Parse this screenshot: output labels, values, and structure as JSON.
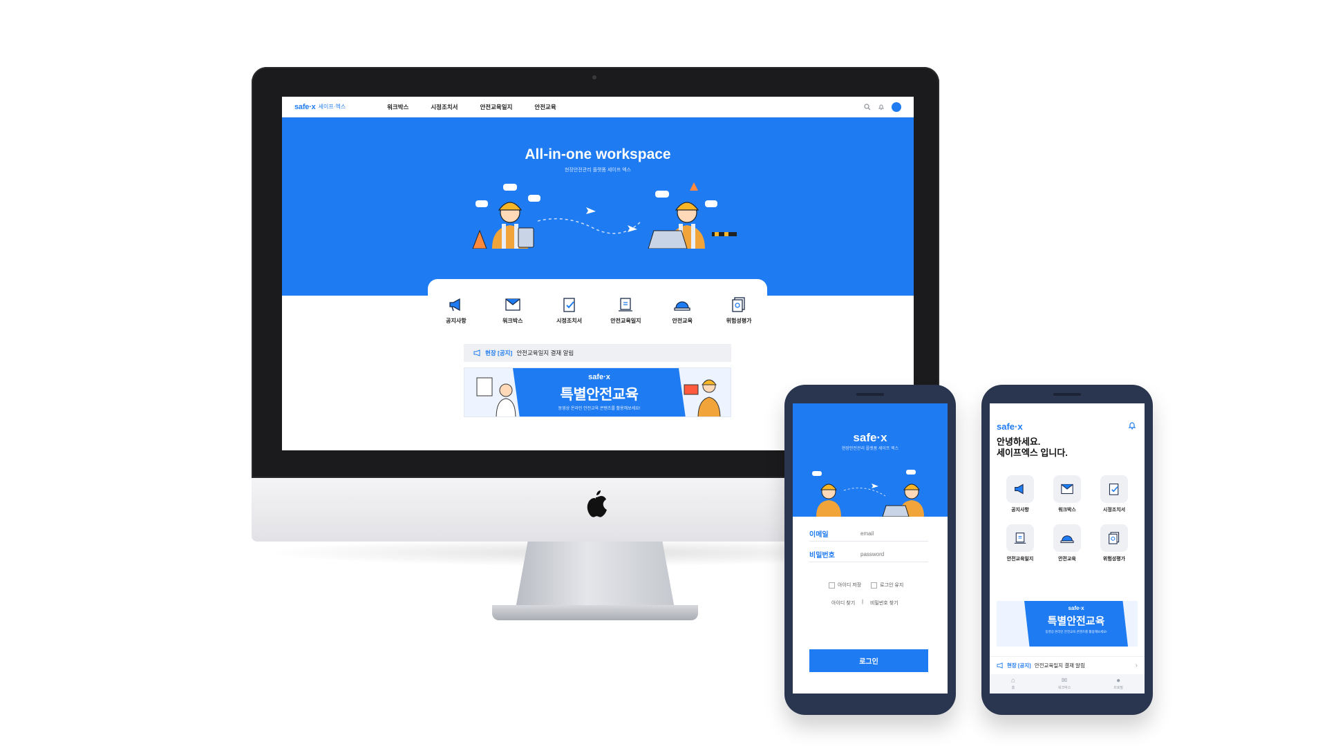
{
  "desktop": {
    "logo": "safe·x",
    "logo_sub": "세이프·엑스",
    "nav": [
      "워크박스",
      "시정조치서",
      "안전교육일지",
      "안전교육"
    ],
    "hero_title": "All-in-one workspace",
    "hero_sub": "현장안전관리 플랫폼 세이프 엑스",
    "cards": [
      {
        "label": "공지사항",
        "icon": "megaphone-icon"
      },
      {
        "label": "워크박스",
        "icon": "mail-icon"
      },
      {
        "label": "시정조치서",
        "icon": "checklist-icon"
      },
      {
        "label": "안전교육일지",
        "icon": "journal-icon"
      },
      {
        "label": "안전교육",
        "icon": "helmet-icon"
      },
      {
        "label": "위험성평가",
        "icon": "document-search-icon"
      }
    ],
    "notice": {
      "tag": "현장 [공지]",
      "text": "안전교육일지 결재 알림"
    },
    "banner": {
      "brand": "safe·x",
      "title": "특별안전교육",
      "sub": "동영상 온라인 안전교육 콘텐츠를 활용해보세요!"
    }
  },
  "phone_login": {
    "logo": "safe·x",
    "sub": "현장안전관리 플랫폼 세이프 엑스",
    "email_label": "이메일",
    "email_placeholder": "email",
    "password_label": "비밀번호",
    "password_placeholder": "password",
    "save_id": "아이디 저장",
    "keep_login": "로그인 유지",
    "find_id": "아이디 찾기",
    "separator": "|",
    "find_pw": "비밀번호 찾기",
    "login_button": "로그인"
  },
  "phone_home": {
    "logo": "safe·x",
    "greeting": "안녕하세요.\n세이프엑스 입니다.",
    "items": [
      {
        "label": "공지사항",
        "icon": "megaphone-icon"
      },
      {
        "label": "워크박스",
        "icon": "mail-icon"
      },
      {
        "label": "시정조치서",
        "icon": "checklist-icon"
      },
      {
        "label": "안전교육일지",
        "icon": "journal-icon"
      },
      {
        "label": "안전교육",
        "icon": "helmet-icon"
      },
      {
        "label": "위험성평가",
        "icon": "document-search-icon"
      }
    ],
    "banner": {
      "brand": "safe·x",
      "title": "특별안전교육",
      "sub": "동영상 온라인 안전교육 콘텐츠를 활용해보세요!"
    },
    "notice": {
      "tag": "현장 [공지]",
      "text": "안전교육일지 결재 알림"
    },
    "tabs": [
      {
        "label": "홈",
        "icon": "home-icon"
      },
      {
        "label": "워크박스",
        "icon": "mail-icon"
      },
      {
        "label": "프로필",
        "icon": "user-icon"
      }
    ]
  },
  "colors": {
    "brand": "#1e7bf2",
    "phone_body": "#2a3650"
  }
}
